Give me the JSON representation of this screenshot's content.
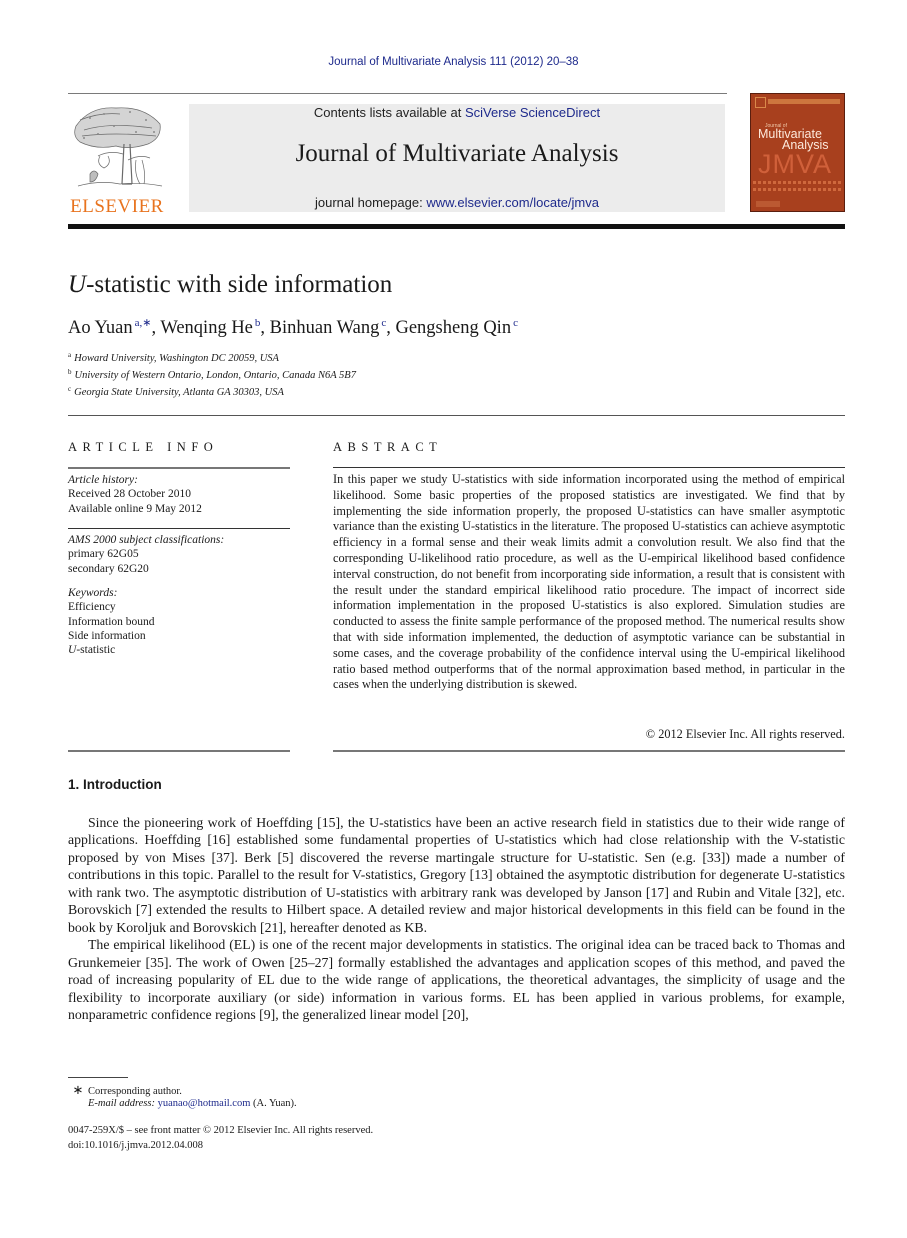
{
  "running_head": "Journal of Multivariate Analysis 111 (2012) 20–38",
  "header": {
    "publisher_logo_text": "ELSEVIER",
    "contents_prefix": "Contents lists available at ",
    "contents_link": "SciVerse ScienceDirect",
    "journal_title": "Journal of Multivariate Analysis",
    "homepage_prefix": "journal homepage: ",
    "homepage_link": "www.elsevier.com/locate/jmva",
    "cover": {
      "small": "Journal of",
      "line1": "Multivariate",
      "line2": "Analysis",
      "acronym": "JMVA"
    }
  },
  "article": {
    "title_italic": "U",
    "title_rest": "-statistic with side information",
    "authors": [
      {
        "name": "Ao Yuan",
        "sup": "a,∗"
      },
      {
        "name": "Wenqing He",
        "sup": "b"
      },
      {
        "name": "Binhuan Wang",
        "sup": "c"
      },
      {
        "name": "Gengsheng Qin",
        "sup": "c"
      }
    ],
    "affiliations": [
      {
        "key": "a",
        "text": "Howard University, Washington DC 20059, USA"
      },
      {
        "key": "b",
        "text": "University of Western Ontario, London, Ontario, Canada N6A 5B7"
      },
      {
        "key": "c",
        "text": "Georgia State University, Atlanta GA 30303, USA"
      }
    ]
  },
  "article_info": {
    "heading": "ARTICLE INFO",
    "history_label": "Article history:",
    "received": "Received 28 October 2010",
    "available": "Available online 9 May 2012",
    "ams_label": "AMS 2000 subject classifications:",
    "primary": "primary 62G05",
    "secondary": "secondary 62G20",
    "keywords_label": "Keywords:",
    "keywords": [
      "Efficiency",
      "Information bound",
      "Side information"
    ],
    "keyword_last_italic": "U",
    "keyword_last_rest": "-statistic"
  },
  "abstract": {
    "heading": "ABSTRACT",
    "text": "In this paper we study U-statistics with side information incorporated using the method of empirical likelihood. Some basic properties of the proposed statistics are investigated. We find that by implementing the side information properly, the proposed U-statistics can have smaller asymptotic variance than the existing U-statistics in the literature. The proposed U-statistics can achieve asymptotic efficiency in a formal sense and their weak limits admit a convolution result. We also find that the corresponding U-likelihood ratio procedure, as well as the U-empirical likelihood based confidence interval construction, do not benefit from incorporating side information, a result that is consistent with the result under the standard empirical likelihood ratio procedure. The impact of incorrect side information implementation in the proposed U-statistics is also explored. Simulation studies are conducted to assess the finite sample performance of the proposed method. The numerical results show that with side information implemented, the deduction of asymptotic variance can be substantial in some cases, and the coverage probability of the confidence interval using the U-empirical likelihood ratio based method outperforms that of the normal approximation based method, in particular in the cases when the underlying distribution is skewed.",
    "copyright": "© 2012 Elsevier Inc. All rights reserved."
  },
  "introduction": {
    "heading": "1.  Introduction",
    "paragraphs": [
      "Since the pioneering work of Hoeffding [15], the U-statistics have been an active research field in statistics due to their wide range of applications. Hoeffding [16] established some fundamental properties of U-statistics which had close relationship with the V-statistic proposed by von Mises [37]. Berk [5] discovered the reverse martingale structure for U-statistic. Sen (e.g. [33]) made a number of contributions in this topic. Parallel to the result for V-statistics, Gregory [13] obtained the asymptotic distribution for degenerate U-statistics with rank two. The asymptotic distribution of U-statistics with arbitrary rank was developed by Janson [17] and Rubin and Vitale [32], etc. Borovskich [7] extended the results to Hilbert space. A detailed review and major historical developments in this field can be found in the book by Koroljuk and Borovskich [21], hereafter denoted as KB.",
      "The empirical likelihood (EL) is one of the recent major developments in statistics. The original idea can be traced back to Thomas and Grunkemeier [35]. The work of Owen [25–27] formally established the advantages and application scopes of this method, and paved the road of increasing popularity of EL due to the wide range of applications, the theoretical advantages, the simplicity of usage and the flexibility to incorporate auxiliary (or side) information in various forms. EL has been applied in various problems, for example, nonparametric confidence regions [9], the generalized linear model [20],"
    ]
  },
  "footnotes": {
    "star": "∗",
    "corresponding": "Corresponding author.",
    "email_label": "E-mail address: ",
    "email": "yuanao@hotmail.com",
    "email_suffix": " (A. Yuan).",
    "issn": "0047-259X/$ – see front matter © 2012 Elsevier Inc. All rights reserved.",
    "doi": "doi:10.1016/j.jmva.2012.04.008"
  },
  "colors": {
    "link": "#1e2a8c",
    "elsevier_orange": "#e8731e",
    "banner_bg": "#ececec",
    "cover_bg": "#a8401e"
  }
}
